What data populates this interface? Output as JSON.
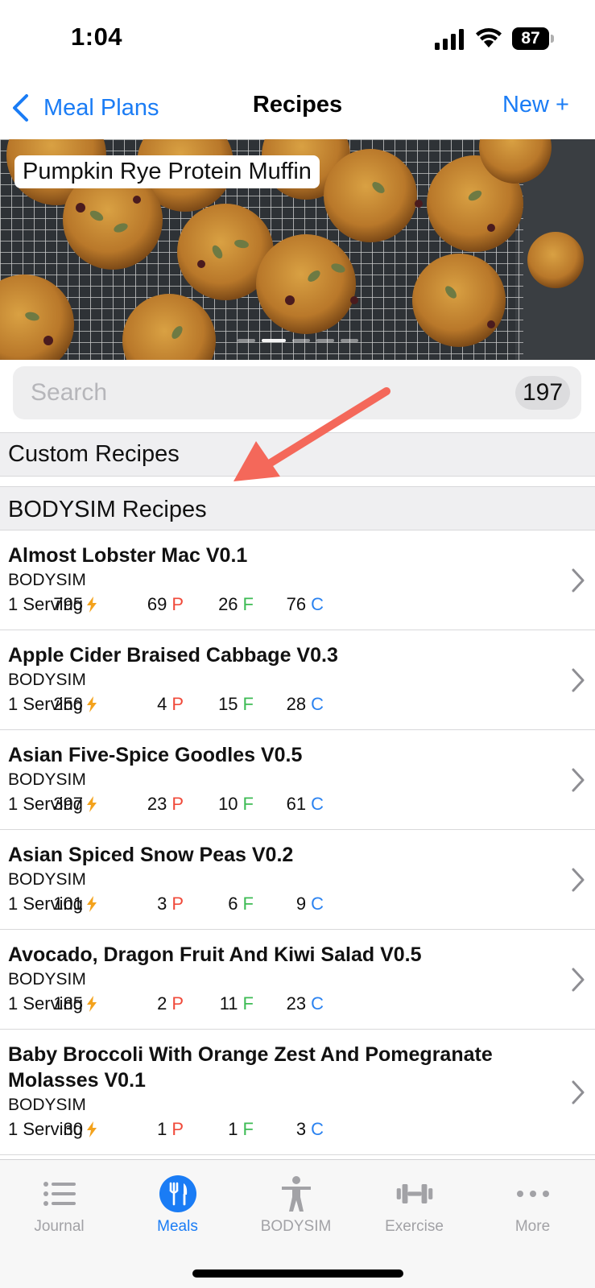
{
  "status_bar": {
    "time": "1:04",
    "battery": "87"
  },
  "nav": {
    "back_label": "Meal Plans",
    "title": "Recipes",
    "new_label": "New +"
  },
  "hero": {
    "label": "Pumpkin Rye Protein Muffin"
  },
  "search": {
    "placeholder": "Search",
    "count": "197"
  },
  "sections": {
    "custom": "Custom Recipes",
    "bodysim": "BODYSIM Recipes"
  },
  "colors": {
    "accent": "#1a7cf5",
    "protein": "#f04a3a",
    "fat": "#3dbb54",
    "carb": "#2a82f0",
    "energy": "#f3a21c",
    "annotation_arrow": "#f4685a"
  },
  "recipes": [
    {
      "name": "Almost Lobster Mac V0.1",
      "source": "BODYSIM",
      "serving": "1 Serving",
      "calories": "795",
      "protein": "69",
      "fat": "26",
      "carbs": "76"
    },
    {
      "name": "Apple Cider Braised Cabbage V0.3",
      "source": "BODYSIM",
      "serving": "1 Serving",
      "calories": "256",
      "protein": "4",
      "fat": "15",
      "carbs": "28"
    },
    {
      "name": "Asian Five-Spice Goodles V0.5",
      "source": "BODYSIM",
      "serving": "1 Serving",
      "calories": "397",
      "protein": "23",
      "fat": "10",
      "carbs": "61"
    },
    {
      "name": "Asian Spiced Snow Peas V0.2",
      "source": "BODYSIM",
      "serving": "1 Serving",
      "calories": "101",
      "protein": "3",
      "fat": "6",
      "carbs": "9"
    },
    {
      "name": "Avocado, Dragon Fruit And Kiwi Salad V0.5",
      "source": "BODYSIM",
      "serving": "1 Serving",
      "calories": "185",
      "protein": "2",
      "fat": "11",
      "carbs": "23"
    },
    {
      "name": "Baby Broccoli With Orange Zest And Pomegranate Molasses V0.1",
      "source": "BODYSIM",
      "serving": "1 Serving",
      "calories": "30",
      "protein": "1",
      "fat": "1",
      "carbs": "3"
    }
  ],
  "macro_letters": {
    "p": "P",
    "f": "F",
    "c": "C"
  },
  "tabs": [
    {
      "label": "Journal",
      "icon": "list-icon",
      "active": false
    },
    {
      "label": "Meals",
      "icon": "fork-knife-icon",
      "active": true
    },
    {
      "label": "BODYSIM",
      "icon": "person-icon",
      "active": false
    },
    {
      "label": "Exercise",
      "icon": "dumbbell-icon",
      "active": false
    },
    {
      "label": "More",
      "icon": "ellipsis-icon",
      "active": false
    }
  ]
}
